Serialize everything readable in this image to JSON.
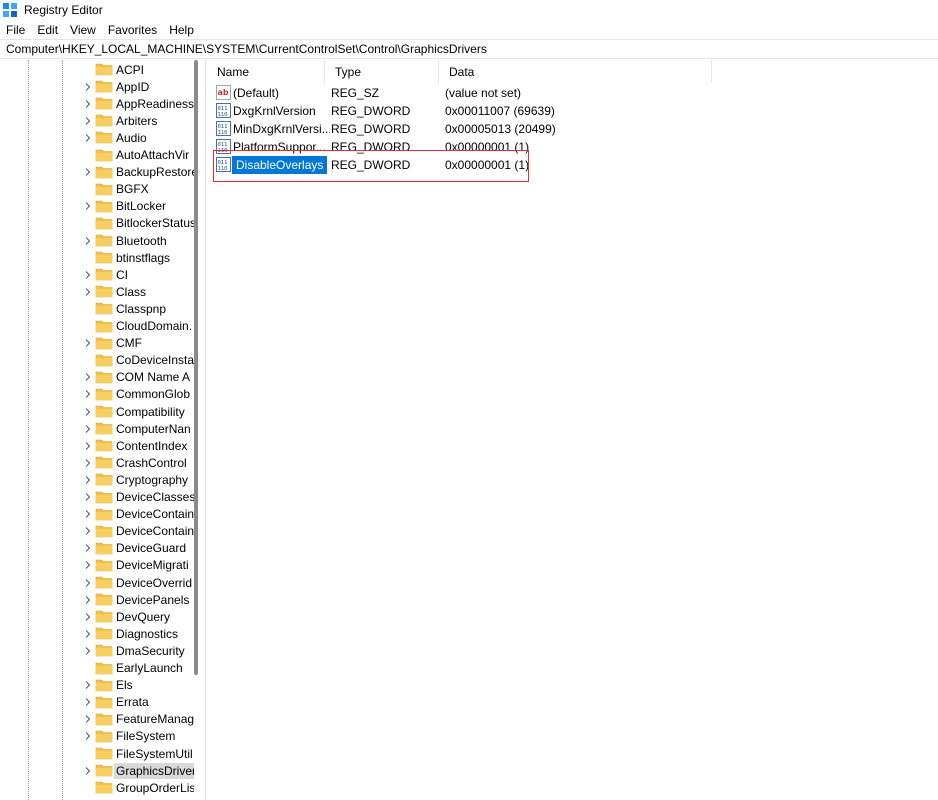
{
  "window": {
    "title": "Registry Editor"
  },
  "menu": [
    "File",
    "Edit",
    "View",
    "Favorites",
    "Help"
  ],
  "address": "Computer\\HKEY_LOCAL_MACHINE\\SYSTEM\\CurrentControlSet\\Control\\GraphicsDrivers",
  "tree": {
    "items": [
      {
        "label": "ACPI",
        "expandable": false,
        "selected": false
      },
      {
        "label": "AppID",
        "expandable": true,
        "selected": false
      },
      {
        "label": "AppReadiness",
        "expandable": true,
        "selected": false
      },
      {
        "label": "Arbiters",
        "expandable": true,
        "selected": false
      },
      {
        "label": "Audio",
        "expandable": true,
        "selected": false
      },
      {
        "label": "AutoAttachVir",
        "expandable": false,
        "selected": false
      },
      {
        "label": "BackupRestore",
        "expandable": true,
        "selected": false
      },
      {
        "label": "BGFX",
        "expandable": false,
        "selected": false
      },
      {
        "label": "BitLocker",
        "expandable": true,
        "selected": false
      },
      {
        "label": "BitlockerStatus",
        "expandable": false,
        "selected": false
      },
      {
        "label": "Bluetooth",
        "expandable": true,
        "selected": false
      },
      {
        "label": "btinstflags",
        "expandable": false,
        "selected": false
      },
      {
        "label": "CI",
        "expandable": true,
        "selected": false
      },
      {
        "label": "Class",
        "expandable": true,
        "selected": false
      },
      {
        "label": "Classpnp",
        "expandable": false,
        "selected": false
      },
      {
        "label": "CloudDomain.",
        "expandable": false,
        "selected": false
      },
      {
        "label": "CMF",
        "expandable": true,
        "selected": false
      },
      {
        "label": "CoDeviceInsta",
        "expandable": false,
        "selected": false
      },
      {
        "label": "COM Name A",
        "expandable": true,
        "selected": false
      },
      {
        "label": "CommonGlob",
        "expandable": true,
        "selected": false
      },
      {
        "label": "Compatibility",
        "expandable": true,
        "selected": false
      },
      {
        "label": "ComputerNan",
        "expandable": true,
        "selected": false
      },
      {
        "label": "ContentIndex",
        "expandable": true,
        "selected": false
      },
      {
        "label": "CrashControl",
        "expandable": true,
        "selected": false
      },
      {
        "label": "Cryptography",
        "expandable": true,
        "selected": false
      },
      {
        "label": "DeviceClasses",
        "expandable": true,
        "selected": false
      },
      {
        "label": "DeviceContain",
        "expandable": true,
        "selected": false
      },
      {
        "label": "DeviceContain",
        "expandable": true,
        "selected": false
      },
      {
        "label": "DeviceGuard",
        "expandable": true,
        "selected": false
      },
      {
        "label": "DeviceMigrati",
        "expandable": true,
        "selected": false
      },
      {
        "label": "DeviceOverrid",
        "expandable": true,
        "selected": false
      },
      {
        "label": "DevicePanels",
        "expandable": true,
        "selected": false
      },
      {
        "label": "DevQuery",
        "expandable": true,
        "selected": false
      },
      {
        "label": "Diagnostics",
        "expandable": true,
        "selected": false
      },
      {
        "label": "DmaSecurity",
        "expandable": true,
        "selected": false
      },
      {
        "label": "EarlyLaunch",
        "expandable": false,
        "selected": false
      },
      {
        "label": "Els",
        "expandable": true,
        "selected": false
      },
      {
        "label": "Errata",
        "expandable": true,
        "selected": false
      },
      {
        "label": "FeatureManag",
        "expandable": true,
        "selected": false
      },
      {
        "label": "FileSystem",
        "expandable": true,
        "selected": false
      },
      {
        "label": "FileSystemUtil",
        "expandable": false,
        "selected": false
      },
      {
        "label": "GraphicsDriver",
        "expandable": true,
        "selected": true
      },
      {
        "label": "GroupOrderLis",
        "expandable": false,
        "selected": false
      }
    ]
  },
  "list": {
    "columns": {
      "name": "Name",
      "type": "Type",
      "data": "Data"
    },
    "rows": [
      {
        "name": "(Default)",
        "type": "REG_SZ",
        "data": "(value not set)",
        "icon": "string-value-icon",
        "selected": false
      },
      {
        "name": "DxgKrnlVersion",
        "type": "REG_DWORD",
        "data": "0x00011007 (69639)",
        "icon": "dword-value-icon",
        "selected": false
      },
      {
        "name": "MinDxgKrnlVersi...",
        "type": "REG_DWORD",
        "data": "0x00005013 (20499)",
        "icon": "dword-value-icon",
        "selected": false
      },
      {
        "name": "PlatformSuppor...",
        "type": "REG_DWORD",
        "data": "0x00000001 (1)",
        "icon": "dword-value-icon",
        "selected": false
      },
      {
        "name": "DisableOverlays",
        "type": "REG_DWORD",
        "data": "0x00000001 (1)",
        "icon": "dword-value-icon",
        "selected": true
      }
    ]
  },
  "colors": {
    "selection": "#0078d7",
    "tree_selection": "#d9d9d9",
    "annotation_box": "#e03030",
    "folder": "#f3c14a"
  }
}
